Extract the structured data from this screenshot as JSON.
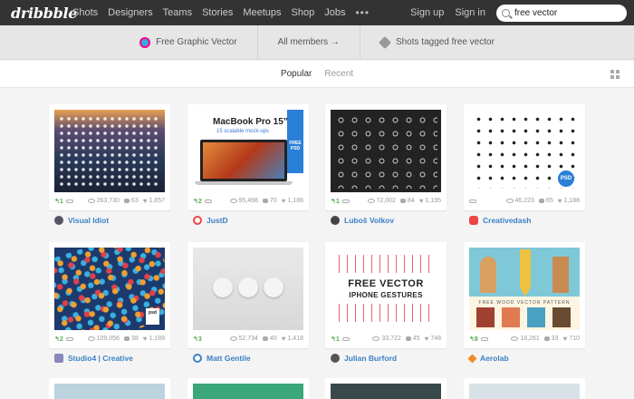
{
  "nav": {
    "logo": "dribbble",
    "links": [
      "Shots",
      "Designers",
      "Teams",
      "Stories",
      "Meetups",
      "Shop",
      "Jobs"
    ],
    "more": "•••",
    "sign_up": "Sign up",
    "sign_in": "Sign in",
    "search_value": "free vector"
  },
  "tagbar": {
    "tag_title": "Free Graphic Vector",
    "members": "All members →",
    "shots_tagged": "Shots tagged free vector"
  },
  "filter": {
    "tabs": [
      "Popular",
      "Recent"
    ]
  },
  "shots": [
    {
      "rebounds": "1",
      "views": "263,730",
      "comments": "63",
      "likes": "1,857",
      "author": "Visual Idiot",
      "avatar_color": "#556"
    },
    {
      "rebounds": "2",
      "views": "95,498",
      "comments": "70",
      "likes": "1,186",
      "author": "JustD",
      "avatar_color": "#e44"
    },
    {
      "rebounds": "1",
      "views": "72,002",
      "comments": "84",
      "likes": "1,195",
      "author": "Luboš Volkov",
      "avatar_color": "#444"
    },
    {
      "rebounds": "",
      "views": "46,223",
      "comments": "65",
      "likes": "1,188",
      "author": "Creativedash",
      "avatar_color": "#e44"
    },
    {
      "rebounds": "2",
      "views": "109,056",
      "comments": "38",
      "likes": "1,189",
      "author": "Studio4 | Creative",
      "avatar_color": "#8888bb"
    },
    {
      "rebounds": "3",
      "views": "52,734",
      "comments": "40",
      "likes": "1,418",
      "author": "Matt Gentile",
      "avatar_color": "#3a81c4"
    },
    {
      "rebounds": "1",
      "views": "33,722",
      "comments": "45",
      "likes": "748",
      "author": "Julian Burford",
      "avatar_color": "#555"
    },
    {
      "rebounds": "8",
      "views": "18,261",
      "comments": "33",
      "likes": "710",
      "author": "Aerolab",
      "avatar_color": "#f08a24"
    }
  ],
  "thumbs": {
    "mac_title": "MacBook Pro 15”",
    "mac_sub": "15 scalable mock-ups",
    "mac_ribbon": "FREE PSD",
    "psd": "PSD",
    "psd_small": "psd",
    "gest_title": "FREE VECTOR",
    "gest_sub": "IPHONE GESTURES",
    "wood_label": "FREE WOOD VECTOR PATTERN"
  }
}
